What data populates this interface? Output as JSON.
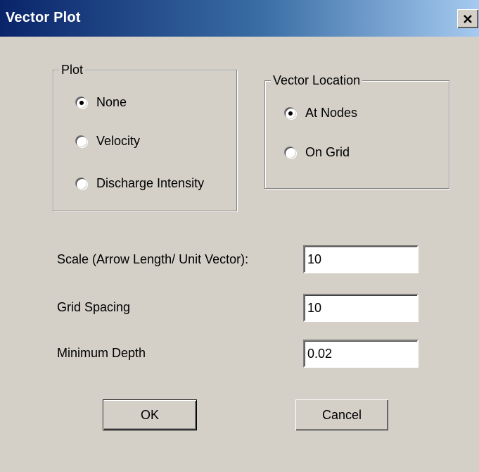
{
  "window": {
    "title": "Vector Plot",
    "close_glyph": "✕"
  },
  "plot_group": {
    "legend": "Plot",
    "options": [
      {
        "label": "None",
        "selected": true
      },
      {
        "label": "Velocity",
        "selected": false
      },
      {
        "label": "Discharge Intensity",
        "selected": false
      }
    ]
  },
  "location_group": {
    "legend": "Vector Location",
    "options": [
      {
        "label": "At Nodes",
        "selected": true
      },
      {
        "label": "On Grid",
        "selected": false
      }
    ]
  },
  "fields": {
    "scale": {
      "label": "Scale (Arrow Length/ Unit Vector):",
      "value": "10"
    },
    "grid_spacing": {
      "label": "Grid Spacing",
      "value": "10"
    },
    "minimum_depth": {
      "label": "Minimum Depth",
      "value": "0.02"
    }
  },
  "buttons": {
    "ok": "OK",
    "cancel": "Cancel"
  }
}
